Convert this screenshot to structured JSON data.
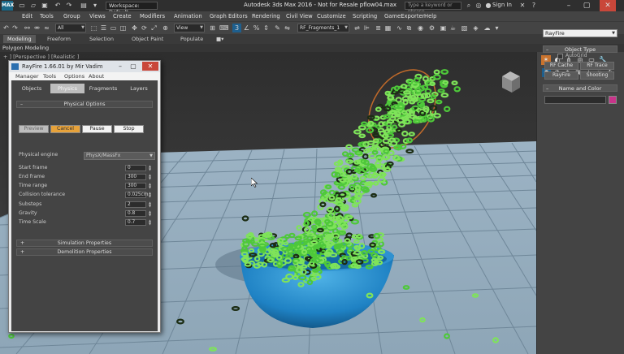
{
  "titlebar": {
    "logo": "MAX",
    "workspace": "Workspace: Default",
    "title": "Autodesk 3ds Max 2016 - Not for Resale    pflow04.max",
    "search_placeholder": "Type a keyword or phrase",
    "sign_in": "Sign In",
    "icons": [
      "new-icon",
      "open-icon",
      "save-icon",
      "undo-icon",
      "redo-icon",
      "project-icon"
    ]
  },
  "menu": [
    "Edit",
    "Tools",
    "Group",
    "Views",
    "Create",
    "Modifiers",
    "Animation",
    "Graph Editors",
    "Rendering",
    "Civil View",
    "Customize",
    "Scripting",
    "GameExporter",
    "Help"
  ],
  "toolbar": {
    "selection_filter": "All",
    "reference_coord": "View",
    "named_selection": "RF_Fragments_1"
  },
  "ribbon": {
    "tabs": [
      "Modeling",
      "Freeform",
      "Selection",
      "Object Paint",
      "Populate"
    ],
    "sub_label": "Polygon Modeling"
  },
  "viewport": {
    "label": "+ ] [Perspective ] [Realistic ]"
  },
  "command_panel": {
    "category": "RayFire",
    "object_type_title": "Object Type",
    "autogrid": "AutoGrid",
    "buttons": [
      "RF Cache",
      "RF Trace",
      "RayFire",
      "Shooting"
    ],
    "name_color_title": "Name and Color",
    "color": "#c8348a"
  },
  "rayfire": {
    "title": "RayFire 1.66.01  by Mir Vadim",
    "menu": [
      "Manager",
      "Tools",
      "Options",
      "About"
    ],
    "tabs": [
      "Objects",
      "Physics",
      "Fragments",
      "Layers"
    ],
    "active_tab": "Physics",
    "rollout_title": "Physical Options",
    "buttons": [
      "Preview",
      "Cancel",
      "Pause",
      "Stop"
    ],
    "engine_label": "Physical engine",
    "engine_value": "PhysX/MassFx",
    "fields": [
      {
        "label": "Start frame",
        "value": "0"
      },
      {
        "label": "End frame",
        "value": "300"
      },
      {
        "label": "Time range",
        "value": "300"
      },
      {
        "label": "Collision tolerance",
        "value": "0.025cm"
      },
      {
        "label": "Substeps",
        "value": "2"
      },
      {
        "label": "Gravity",
        "value": "0.8"
      },
      {
        "label": "Time Scale",
        "value": "0.7"
      }
    ],
    "collapsed_rollouts": [
      "Simulation Properties",
      "Demolition Properties"
    ]
  }
}
